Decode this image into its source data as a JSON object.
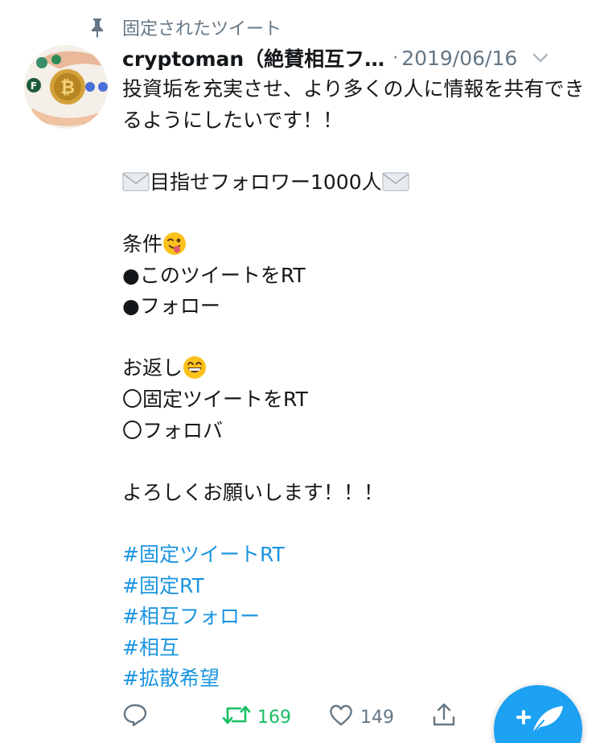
{
  "pinned": {
    "label": "固定されたツイート",
    "icon": "pin-icon"
  },
  "author": {
    "name": "cryptoman（絶賛相互フ…",
    "separator": "·",
    "date": "2019/06/16",
    "avatar_icon": "bitcoin-avatar"
  },
  "tweet": {
    "intro": "投資垢を充実させ、より多くの人に情報を共有できるようにしたいです！！",
    "goal_text": "目指せフォロワー1000人",
    "conditions_title": "条件",
    "condition_1": "●このツイートをRT",
    "condition_2": "●フォロー",
    "return_title": "お返し",
    "return_1": "〇固定ツイートをRT",
    "return_2": "〇フォロバ",
    "closing": "よろしくお願いします！！！",
    "hashtags": [
      "#固定ツイートRT",
      "#固定RT",
      "#相互フォロー",
      "#相互",
      "#拡散希望"
    ]
  },
  "actions": {
    "reply_icon": "reply-icon",
    "retweet_icon": "retweet-icon",
    "retweet_count": "169",
    "like_icon": "heart-icon",
    "like_count": "149",
    "share_icon": "share-icon"
  },
  "compose_icon": "compose-tweet-icon",
  "colors": {
    "text": "#14171a",
    "secondary": "#657786",
    "hashtag": "#1b95e0",
    "retweet_green": "#17bf63",
    "fab_blue": "#1da1f2"
  }
}
